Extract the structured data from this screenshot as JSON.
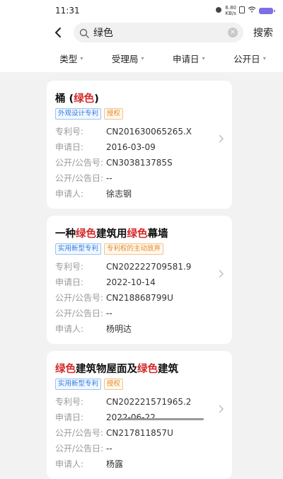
{
  "status": {
    "time": "11:31",
    "net_speed": "6.80",
    "net_unit": "KB/s"
  },
  "search": {
    "query": "绿色",
    "button_label": "搜索"
  },
  "filters": [
    "类型",
    "受理局",
    "申请日",
    "公开日"
  ],
  "field_labels": {
    "patent_no": "专利号:",
    "apply_date": "申请日:",
    "pub_no": "公开/公告号:",
    "pub_date": "公开/公告日:",
    "applicant": "申请人:"
  },
  "results": [
    {
      "title_parts": [
        "桶 (",
        "绿色",
        ")"
      ],
      "tags": [
        {
          "text": "外观设计专利",
          "color": "blue"
        },
        {
          "text": "授权",
          "color": "orange"
        }
      ],
      "patent_no": "CN201630065265.X",
      "apply_date": "2016-03-09",
      "pub_no": "CN303813785S",
      "pub_date": "--",
      "applicant": "徐志钢"
    },
    {
      "title_parts": [
        "一种",
        "绿色",
        "建筑用",
        "绿色",
        "幕墙"
      ],
      "tags": [
        {
          "text": "实用新型专利",
          "color": "blue"
        },
        {
          "text": "专利权的主动放弃",
          "color": "orange"
        }
      ],
      "patent_no": "CN202222709581.9",
      "apply_date": "2022-10-14",
      "pub_no": "CN218868799U",
      "pub_date": "--",
      "applicant": "杨明达"
    },
    {
      "title_parts": [
        "",
        "绿色",
        "建筑物屋面及",
        "绿色",
        "建筑"
      ],
      "tags": [
        {
          "text": "实用新型专利",
          "color": "blue"
        },
        {
          "text": "授权",
          "color": "orange"
        }
      ],
      "patent_no": "CN202221571965.2",
      "apply_date": "2022-06-22",
      "pub_no": "CN217811857U",
      "pub_date": "--",
      "applicant": "杨露"
    }
  ],
  "colors": {
    "highlight": "#d42a2a",
    "tag_blue": "#2f7ce0",
    "tag_orange": "#e48a23"
  }
}
